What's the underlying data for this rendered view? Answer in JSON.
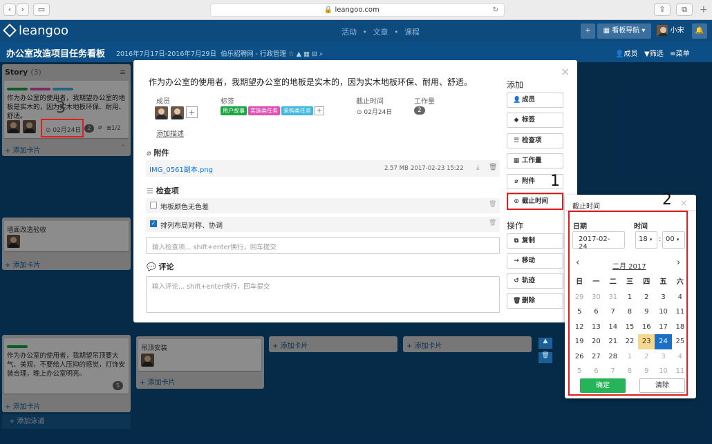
{
  "browser": {
    "url": "leangoo.com",
    "back": "‹",
    "fwd": "›"
  },
  "app": {
    "logo": "leangoo",
    "nav": [
      "活动",
      "文章",
      "课程"
    ],
    "nav_sep": "•",
    "plus": "+",
    "board_nav": "看板导航",
    "user": "小宋"
  },
  "board": {
    "title": "办公室改造项目任务看板",
    "dates": "2016年7月17日-2016年7月29日",
    "team": "伯乐招聘网 - 行政管理",
    "members": "成员",
    "filter": "筛选",
    "menu": "菜单"
  },
  "lists": {
    "story": {
      "title": "Story",
      "count": "(3)",
      "card_text": "作为办公室的使用者，我期望办公室的地板是实木的，因为实木地板环保、耐用、舒适。",
      "due": "02月24日",
      "workload": "2",
      "check": "1/2",
      "add": "+ 添加卡片"
    },
    "list2": {
      "card_text": "墙面改造验收",
      "add": "+ 添加卡片"
    },
    "list3": {
      "card_text": "作为办公室的使用者，我期望吊顶要大气、美观，不要给人压抑的感觉，灯饰安装合理，晚上办公室明亮。",
      "badge": "5",
      "add": "+ 添加卡片"
    },
    "list4": {
      "card_text": "吊顶安装",
      "add": "+ 添加卡片"
    },
    "add_more": [
      "+ 添加卡片",
      "+ 添加卡片"
    ],
    "add_lane": "+ 添加泳道"
  },
  "modal": {
    "title": "作为办公室的使用者，我期望办公室的地板是实木的，因为实木地板环保、耐用、舒适。",
    "members_label": "成员",
    "tags_label": "标签",
    "due_label": "截止时间",
    "work_label": "工作量",
    "tags": [
      {
        "text": "用户故事",
        "color": "#19a742"
      },
      {
        "text": "实施类任务",
        "color": "#e14fb5"
      },
      {
        "text": "采购类任务",
        "color": "#3fb7e0"
      }
    ],
    "due_value": "02月24日",
    "work_value": "2",
    "add_desc": "添加描述",
    "attachments_label": "附件",
    "attachment": {
      "name": "IMG_0561副本.png",
      "size": "2.57 MB",
      "date": "2017-02-23 15:22"
    },
    "checklist_label": "检查项",
    "checks": [
      {
        "text": "地板颜色无色差",
        "done": false
      },
      {
        "text": "排列布局对称、协调",
        "done": true
      }
    ],
    "check_placeholder": "输入检查项... shift+enter换行，回车提交",
    "comments_label": "评论",
    "comment_placeholder": "输入评论... shift+enter换行，回车提交",
    "side_add": "添加",
    "side_buttons": [
      "成员",
      "标签",
      "检查项",
      "工作量",
      "附件",
      "截止时间"
    ],
    "side_ops": "操作",
    "op_buttons": [
      "复制",
      "移动",
      "轨迹",
      "删除"
    ]
  },
  "datepicker": {
    "title": "截止时间",
    "date_label": "日期",
    "time_label": "时间",
    "date_value": "2017-02-24",
    "hour": "18",
    "minute": "00",
    "colon": ":",
    "month": "二月 2017",
    "prev": "‹",
    "next": "›",
    "weekdays": [
      "日",
      "一",
      "二",
      "三",
      "四",
      "五",
      "六"
    ],
    "weeks": [
      [
        "29",
        "30",
        "31",
        "1",
        "2",
        "3",
        "4"
      ],
      [
        "5",
        "6",
        "7",
        "8",
        "9",
        "10",
        "11"
      ],
      [
        "12",
        "13",
        "14",
        "15",
        "16",
        "17",
        "18"
      ],
      [
        "19",
        "20",
        "21",
        "22",
        "23",
        "24",
        "25"
      ],
      [
        "26",
        "27",
        "28",
        "1",
        "2",
        "3",
        "4"
      ],
      [
        "5",
        "6",
        "7",
        "8",
        "9",
        "10",
        "11"
      ]
    ],
    "today": "23",
    "selected": "24",
    "confirm": "确定",
    "clear": "清除"
  },
  "annotations": {
    "n1": "1",
    "n2": "2",
    "n3": "3"
  },
  "colors": {
    "accent": "#1a6fc9",
    "confirm": "#27b35a",
    "highlight": "#e01c1c"
  }
}
